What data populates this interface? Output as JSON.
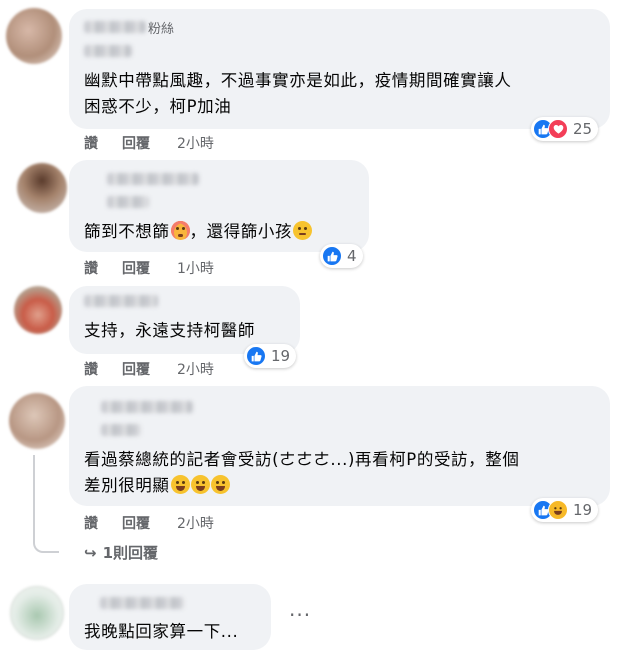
{
  "comments": [
    {
      "name_suffix": "粉絲",
      "text_lines": [
        "幽默中帶點風趣，不過事實亦是如此，疫情期間確實讓人",
        "困惑不少，柯P加油"
      ],
      "like": "讚",
      "reply": "回覆",
      "time": "2小時",
      "reactions": [
        "like-icon",
        "love-icon"
      ],
      "reaction_count": "25"
    },
    {
      "text_parts": [
        "篩到不想篩",
        "，還得篩小孩"
      ],
      "like": "讚",
      "reply": "回覆",
      "time": "1小時",
      "reactions": [
        "like-icon"
      ],
      "reaction_count": "4"
    },
    {
      "text_lines": [
        "支持，永遠支持柯醫師"
      ],
      "like": "讚",
      "reply": "回覆",
      "time": "2小時",
      "reactions": [
        "like-icon"
      ],
      "reaction_count": "19"
    },
    {
      "text_lines": [
        "看過蔡總統的記者會受訪(ㄜㄜㄜ...)再看柯P的受訪，整個",
        "差別很明顯"
      ],
      "like": "讚",
      "reply": "回覆",
      "time": "2小時",
      "reactions": [
        "like-icon",
        "haha-icon"
      ],
      "reaction_count": "19",
      "replies_link": "1則回覆"
    },
    {
      "text_lines": [
        "我晚點回家算一下..."
      ],
      "more_icon": "ellipsis-icon"
    }
  ],
  "colors": {
    "bubble": "#f0f2f5",
    "like": "#1877f2",
    "love": "#f33e58",
    "haha": "#f7b928",
    "muted": "#65676b"
  }
}
